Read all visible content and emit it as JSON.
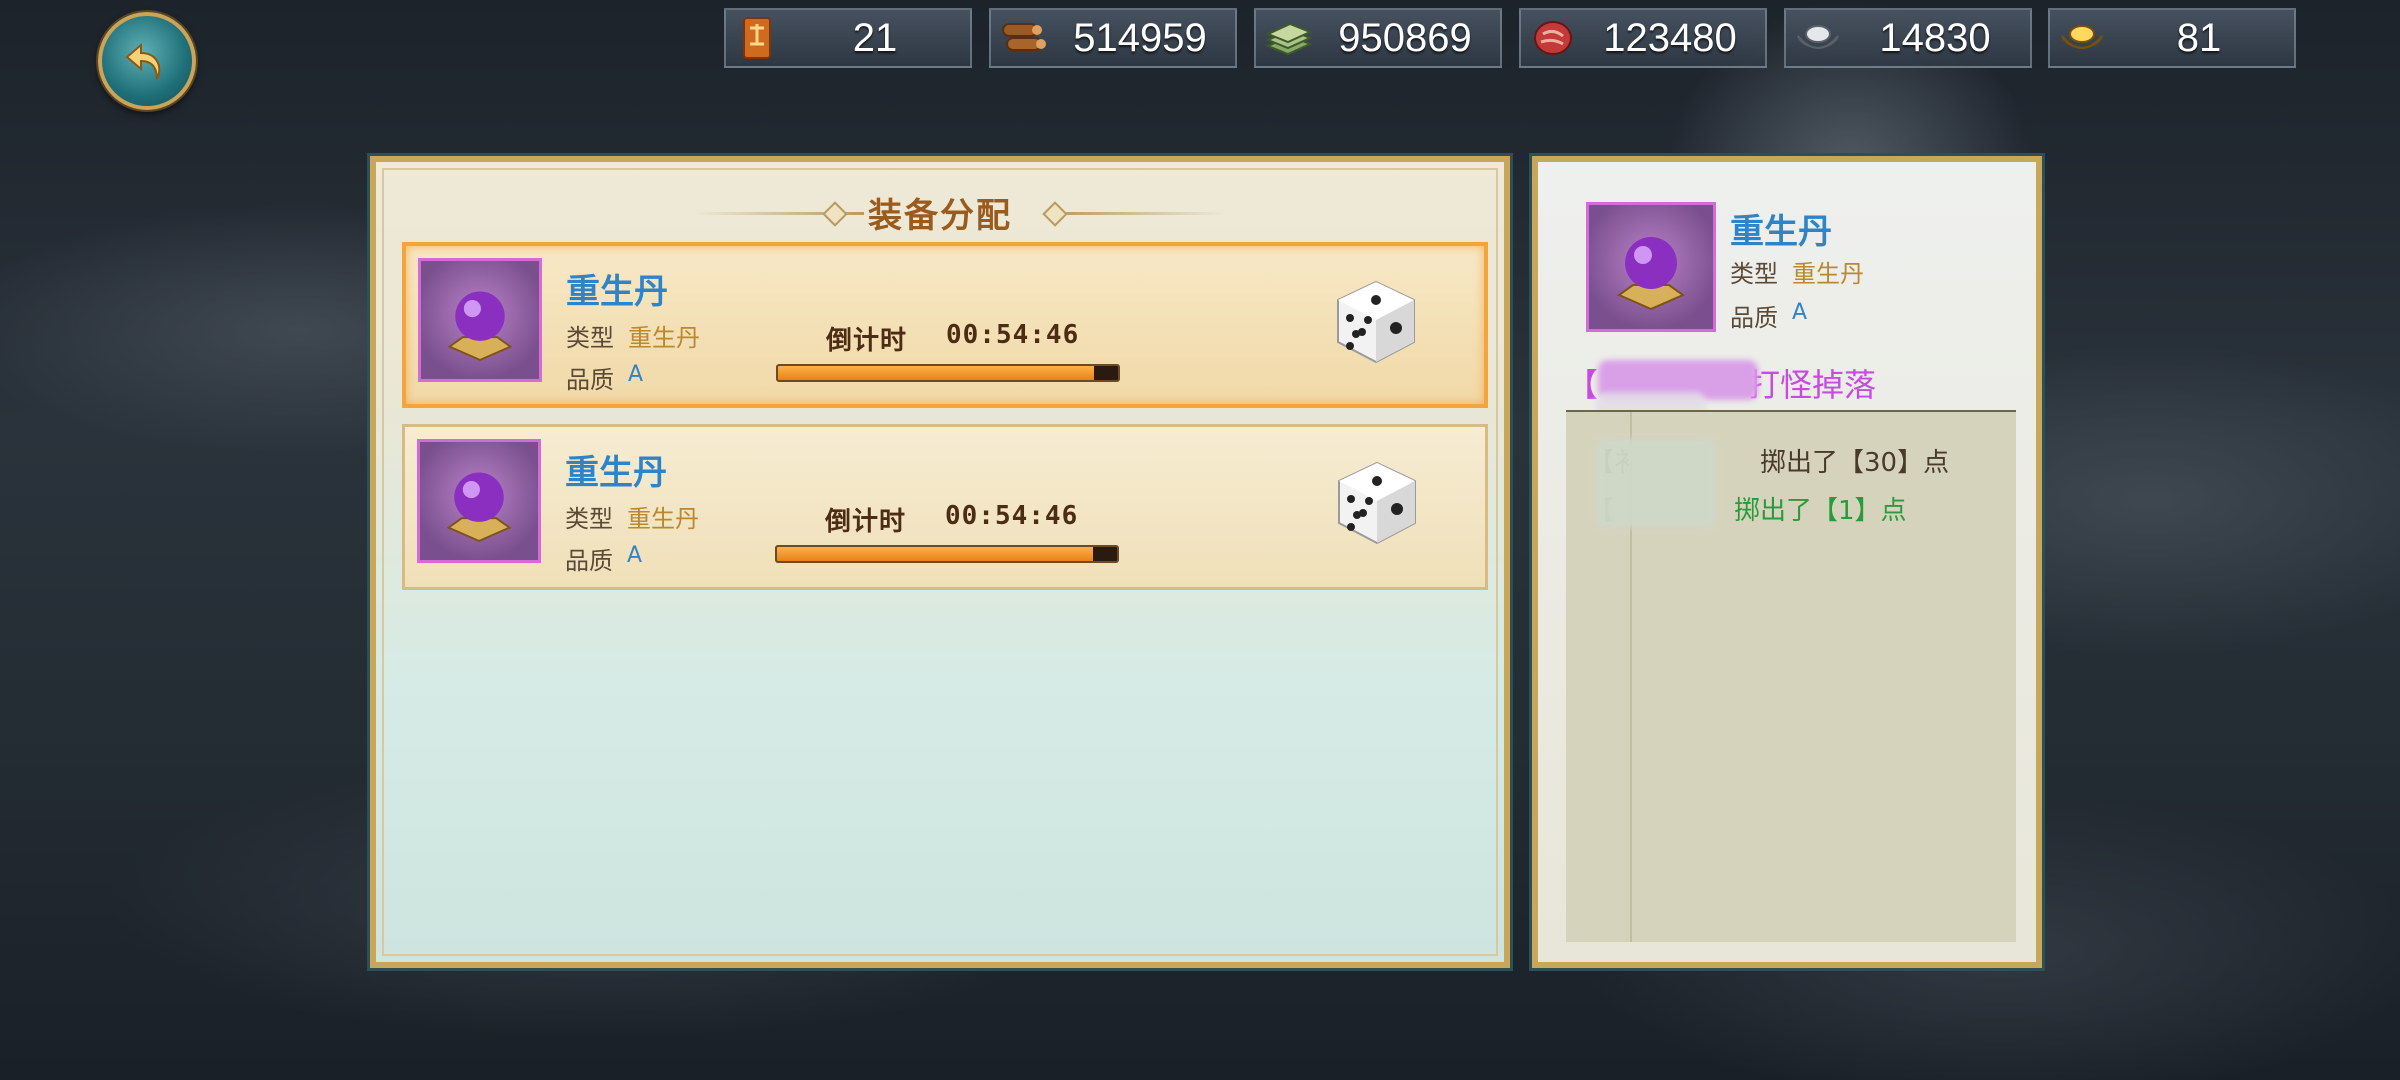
{
  "resources": [
    {
      "icon": "token-scroll-icon",
      "value": "21"
    },
    {
      "icon": "wood-logs-icon",
      "value": "514959"
    },
    {
      "icon": "cash-stack-icon",
      "value": "950869"
    },
    {
      "icon": "meat-icon",
      "value": "123480"
    },
    {
      "icon": "silver-ingot-icon",
      "value": "14830"
    },
    {
      "icon": "gold-ingot-icon",
      "value": "81"
    }
  ],
  "panel": {
    "title": "装备分配",
    "items": [
      {
        "name": "重生丹",
        "type_label": "类型",
        "type_value": "重生丹",
        "quality_label": "品质",
        "quality_value": "A",
        "countdown_label": "倒计时",
        "countdown": "00:54:46",
        "progress": 0.93
      },
      {
        "name": "重生丹",
        "type_label": "类型",
        "type_value": "重生丹",
        "quality_label": "品质",
        "quality_value": "A",
        "countdown_label": "倒计时",
        "countdown": "00:54:46",
        "progress": 0.93
      }
    ]
  },
  "detail": {
    "name": "重生丹",
    "type_label": "类型",
    "type_value": "重生丹",
    "quality_label": "品质",
    "quality_value": "A",
    "source": "【",
    "source_suffix": "打怪掉落",
    "logs": [
      {
        "prefix": "【衤",
        "suffix": "掷出了【30】点",
        "color": "#4a3a2a"
      },
      {
        "prefix": "【",
        "suffix": "掷出了【1】点",
        "color": "#2b9a3a"
      }
    ]
  },
  "colors": {
    "accent_gold": "#c9a75a",
    "name_blue": "#2f84c8",
    "bar_orange": "#e7821a"
  }
}
